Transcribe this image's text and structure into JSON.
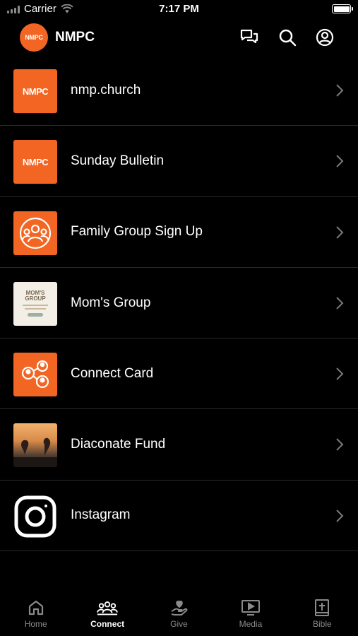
{
  "status_bar": {
    "carrier": "Carrier",
    "time": "7:17 PM"
  },
  "header": {
    "logo_text": "NMPC",
    "title": "NMPC"
  },
  "list": [
    {
      "label": "nmp.church",
      "thumb_text": "NMPC"
    },
    {
      "label": "Sunday Bulletin",
      "thumb_text": "NMPC"
    },
    {
      "label": "Family Group Sign Up"
    },
    {
      "label": "Mom's Group",
      "thumb_text": "MOM'S GROUP"
    },
    {
      "label": "Connect Card"
    },
    {
      "label": "Diaconate Fund"
    },
    {
      "label": "Instagram"
    }
  ],
  "tabbar": [
    {
      "label": "Home",
      "icon": "home-icon"
    },
    {
      "label": "Connect",
      "icon": "people-icon",
      "active": true
    },
    {
      "label": "Give",
      "icon": "give-heart-icon"
    },
    {
      "label": "Media",
      "icon": "play-screen-icon"
    },
    {
      "label": "Bible",
      "icon": "bible-icon"
    }
  ],
  "colors": {
    "accent": "#f26522",
    "background": "#000000",
    "divider": "#2a2a2a",
    "inactive": "#8a8a8a"
  }
}
